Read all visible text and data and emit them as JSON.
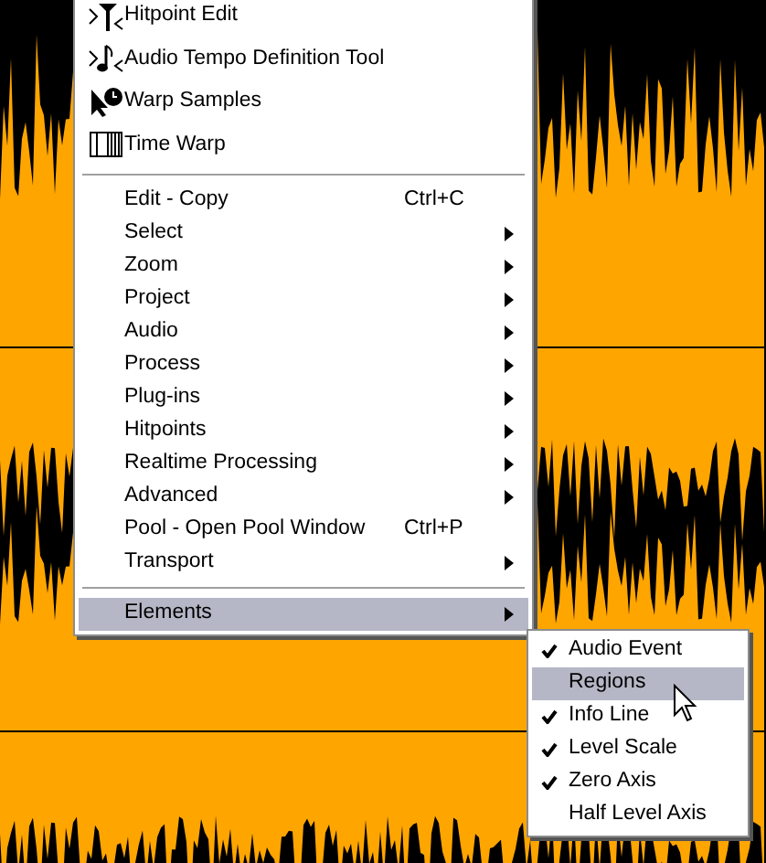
{
  "menu": {
    "tool_items": [
      {
        "label": "Hitpoint Edit",
        "kind": "hitpoint"
      },
      {
        "label": "Audio Tempo Definition Tool",
        "kind": "tempo"
      },
      {
        "label": "Warp Samples",
        "kind": "warp"
      },
      {
        "label": "Time Warp",
        "kind": "timewarp"
      }
    ],
    "items": [
      {
        "label": "Edit - Copy",
        "shortcut": "Ctrl+C",
        "submenu": false
      },
      {
        "label": "Select",
        "submenu": true
      },
      {
        "label": "Zoom",
        "submenu": true
      },
      {
        "label": "Project",
        "submenu": true
      },
      {
        "label": "Audio",
        "submenu": true
      },
      {
        "label": "Process",
        "submenu": true
      },
      {
        "label": "Plug-ins",
        "submenu": true
      },
      {
        "label": "Hitpoints",
        "submenu": true
      },
      {
        "label": "Realtime Processing",
        "submenu": true
      },
      {
        "label": "Advanced",
        "submenu": true
      },
      {
        "label": "Pool - Open Pool Window",
        "shortcut": "Ctrl+P",
        "submenu": false
      },
      {
        "label": "Transport",
        "submenu": true
      }
    ],
    "footer_items": [
      {
        "label": "Elements",
        "submenu": true,
        "selected": true
      }
    ]
  },
  "submenu": {
    "items": [
      {
        "label": "Audio Event",
        "checked": true,
        "selected": false
      },
      {
        "label": "Regions",
        "checked": false,
        "selected": true
      },
      {
        "label": "Info Line",
        "checked": true,
        "selected": false
      },
      {
        "label": "Level Scale",
        "checked": true,
        "selected": false
      },
      {
        "label": "Zero Axis",
        "checked": true,
        "selected": false
      },
      {
        "label": "Half Level Axis",
        "checked": false,
        "selected": false
      }
    ]
  }
}
